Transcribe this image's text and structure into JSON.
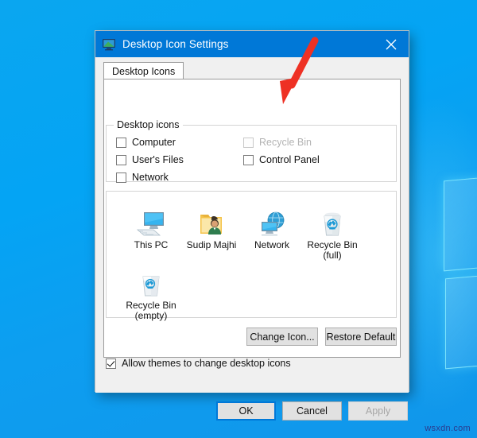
{
  "desktop": {
    "watermark": "wsxdn.com",
    "background_color": "#06a3f2",
    "accent_color": "#0078d7"
  },
  "dialog": {
    "title": "Desktop Icon Settings",
    "title_icon": "desktop-monitor-icon",
    "close_icon": "close-icon",
    "tabs": [
      {
        "label": "Desktop Icons",
        "selected": true
      }
    ],
    "group": {
      "label": "Desktop icons",
      "checkboxes": [
        {
          "label": "Computer",
          "checked": false,
          "disabled": false
        },
        {
          "label": "Recycle Bin",
          "checked": false,
          "disabled": true
        },
        {
          "label": "User's Files",
          "checked": false,
          "disabled": false
        },
        {
          "label": "Control Panel",
          "checked": false,
          "disabled": false
        },
        {
          "label": "Network",
          "checked": false,
          "disabled": false
        }
      ]
    },
    "icon_preview": [
      {
        "caption": "This PC",
        "icon": "this-pc-icon"
      },
      {
        "caption": "Sudip Majhi",
        "icon": "user-folder-icon"
      },
      {
        "caption": "Network",
        "icon": "network-globe-icon"
      },
      {
        "caption": "Recycle Bin\n(full)",
        "icon": "recycle-bin-full-icon"
      },
      {
        "caption": "Recycle Bin\n(empty)",
        "icon": "recycle-bin-empty-icon"
      }
    ],
    "icon_buttons": {
      "change_icon": "Change Icon...",
      "restore_default": "Restore Default"
    },
    "allow_themes": {
      "label": "Allow themes to change desktop icons",
      "checked": true
    },
    "footer_buttons": {
      "ok": "OK",
      "cancel": "Cancel",
      "apply": "Apply"
    }
  },
  "annotation": {
    "arrow_color": "#ee3124",
    "points_to": "Recycle Bin"
  }
}
